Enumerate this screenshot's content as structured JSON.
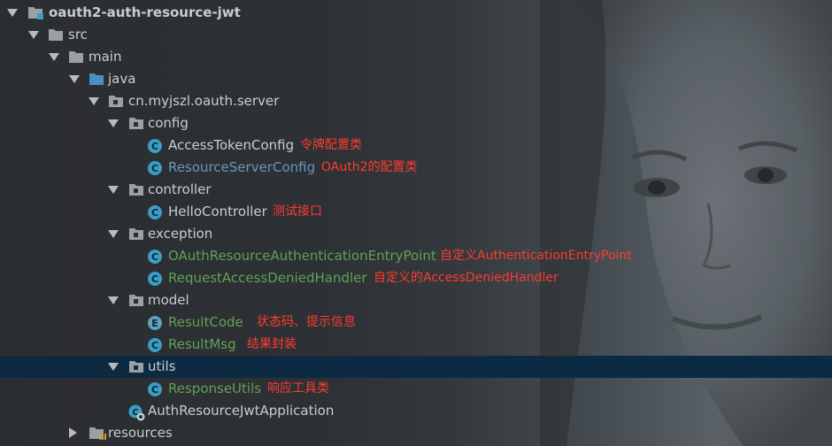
{
  "tree": {
    "project": {
      "name": "oauth2-auth-resource-jwt"
    },
    "src": "src",
    "main": "main",
    "java": "java",
    "package": "cn.myjszl.oauth.server",
    "config": {
      "folder": "config",
      "access_token_config": {
        "name": "AccessTokenConfig",
        "note": "令牌配置类"
      },
      "resource_server_config": {
        "name": "ResourceServerConfig",
        "note": "OAuth2的配置类"
      }
    },
    "controller": {
      "folder": "controller",
      "hello_controller": {
        "name": "HelloController",
        "note": "测试接口"
      }
    },
    "exception": {
      "folder": "exception",
      "entry_point": {
        "name": "OAuthResourceAuthenticationEntryPoint",
        "note": "自定义AuthenticationEntryPoint"
      },
      "denied_handler": {
        "name": "RequestAccessDeniedHandler",
        "note": "自定义的AccessDeniedHandler"
      }
    },
    "model": {
      "folder": "model",
      "result_code": {
        "name": "ResultCode",
        "note": "状态码、提示信息"
      },
      "result_msg": {
        "name": "ResultMsg",
        "note": "结果封装"
      }
    },
    "utils": {
      "folder": "utils",
      "response_utils": {
        "name": "ResponseUtils",
        "note": "响应工具类"
      }
    },
    "application": {
      "name": "AuthResourceJwtApplication"
    },
    "resources": "resources"
  },
  "icons": {
    "class_letter": "C",
    "enum_letter": "E"
  },
  "colors": {
    "annotation": "#ff3b30",
    "modified_file": "#62a157",
    "changed_file": "#6897bb",
    "selection": "#0d2a43"
  }
}
